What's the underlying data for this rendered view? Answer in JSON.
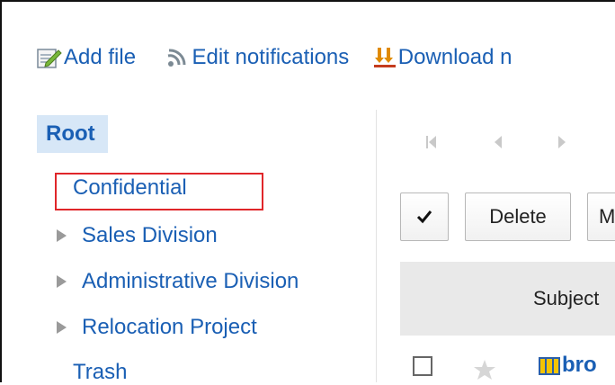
{
  "toolbar": {
    "add_file": "Add file",
    "edit_notifications": "Edit notifications",
    "download": "Download n"
  },
  "tree": {
    "root": "Root",
    "items": [
      {
        "label": "Confidential",
        "expandable": false,
        "selected": true
      },
      {
        "label": "Sales Division",
        "expandable": true
      },
      {
        "label": "Administrative Division",
        "expandable": true
      },
      {
        "label": "Relocation Project",
        "expandable": true
      },
      {
        "label": "Trash",
        "expandable": false
      }
    ]
  },
  "list": {
    "delete_label": "Delete",
    "move_label": "M",
    "subject_header": "Subject",
    "row_name": "bro"
  },
  "colors": {
    "link": "#1a5fb4",
    "root_bg": "#d7e7f7",
    "highlight": "#e0262a"
  }
}
